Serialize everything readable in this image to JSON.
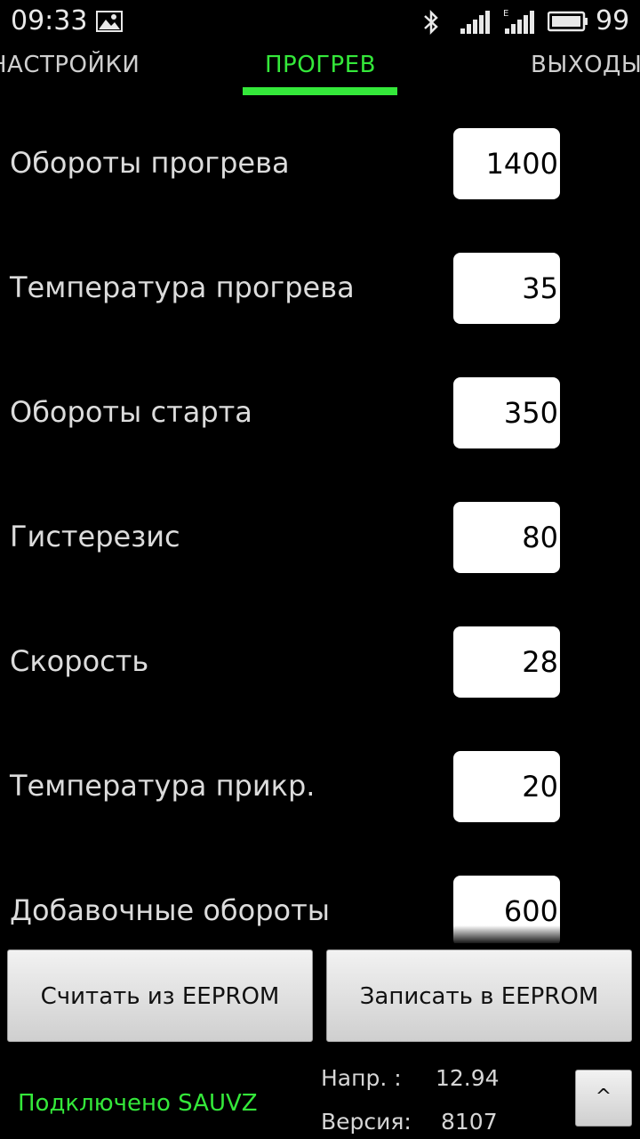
{
  "status_bar": {
    "time": "09:33",
    "battery_percent": "99",
    "icons": [
      "image-icon",
      "bluetooth-icon",
      "signal-icon",
      "signal-e-icon",
      "battery-icon"
    ]
  },
  "tabs": {
    "left": "НАСТРОЙКИ",
    "center": "ПРОГРЕВ",
    "right": "ВЫХОДЫ",
    "active_color": "#34e83a"
  },
  "rows": [
    {
      "label": "Обороты прогрева",
      "value": "1400"
    },
    {
      "label": "Температура прогрева",
      "value": "35"
    },
    {
      "label": "Обороты старта",
      "value": "350"
    },
    {
      "label": "Гистерезис",
      "value": "80"
    },
    {
      "label": "Скорость",
      "value": "28"
    },
    {
      "label": "Температура прикр.",
      "value": "20"
    },
    {
      "label": "Добавочные обороты",
      "value": "600"
    }
  ],
  "buttons": {
    "read": "Считать из EEPROM",
    "write": "Записать в EEPROM",
    "up": "^"
  },
  "footer": {
    "connection": "Подключено SAUVZ",
    "voltage_label": "Напр. :",
    "voltage_value": "12.94",
    "version_label": "Версия:",
    "version_value": "8107"
  }
}
